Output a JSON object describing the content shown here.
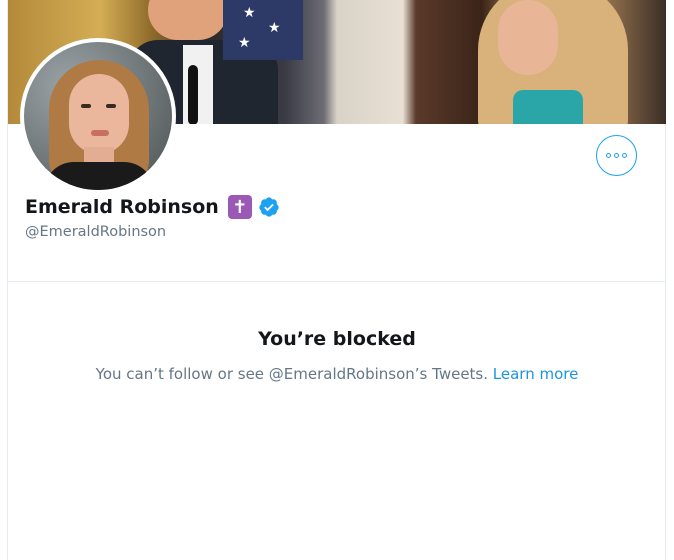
{
  "profile": {
    "name": "Emerald Robinson",
    "badge_symbol": "✝",
    "handle": "@EmeraldRobinson",
    "verified": true
  },
  "colors": {
    "accent": "#1da1f2",
    "link": "#1b95e0",
    "secondary_text": "#657786",
    "badge_purple": "#9b59b6"
  },
  "icons": {
    "more": "more-options-icon",
    "verified": "verified-badge-icon",
    "badge": "latin-cross-icon"
  },
  "blocked": {
    "title": "You’re blocked",
    "message": "You can’t follow or see @EmeraldRobinson’s Tweets.",
    "link_label": "Learn more"
  }
}
